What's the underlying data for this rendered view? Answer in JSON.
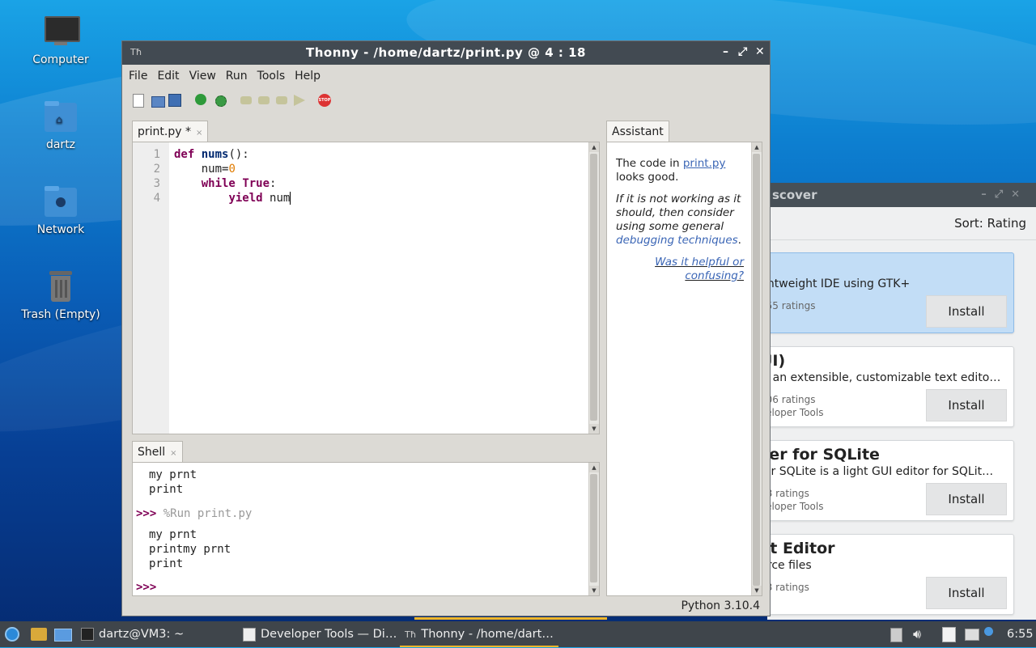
{
  "desktop": {
    "icons": [
      {
        "label": "Computer",
        "icon": "monitor-icon"
      },
      {
        "label": "dartz",
        "icon": "home-folder-icon"
      },
      {
        "label": "Network",
        "icon": "network-folder-icon"
      },
      {
        "label": "Trash (Empty)",
        "icon": "trash-icon"
      }
    ]
  },
  "discover": {
    "title": "scover",
    "sort_label": "Sort: Rating",
    "cards": [
      {
        "title": "",
        "desc": "ghtweight IDE using GTK+",
        "ratings": "155 ratings",
        "category": "",
        "install": "Install",
        "selected": true
      },
      {
        "title": "UI)",
        "desc": "is an extensible, customizable text edito…",
        "ratings": "106 ratings",
        "category": "veloper Tools",
        "install": "Install",
        "selected": false
      },
      {
        "title": "ser for SQLite",
        "desc": "for SQLite is a light GUI editor for SQLit…",
        "ratings": "88 ratings",
        "category": "veloper Tools",
        "install": "Install",
        "selected": false
      },
      {
        "title": "xt Editor",
        "desc": "urce files",
        "ratings": "18 ratings",
        "category": "",
        "install": "Install",
        "selected": false
      }
    ]
  },
  "thonny": {
    "app_icon": "Tħ",
    "title": "Thonny  -  /home/dartz/print.py  @  4 : 18",
    "window_buttons": {
      "minimize": "–",
      "maximize": "⤢",
      "close": "✕"
    },
    "menu": [
      "File",
      "Edit",
      "View",
      "Run",
      "Tools",
      "Help"
    ],
    "editor": {
      "tab_label": "print.py *",
      "line_numbers": [
        "1",
        "2",
        "3",
        "4"
      ]
    },
    "assistant": {
      "tab_label": "Assistant",
      "line1_prefix": "The code in ",
      "line1_link": "print.py",
      "line2": "looks good.",
      "para2_a": "If it is not working as it should, then consider using some general ",
      "para2_link": "debugging techniques",
      "para2_end": ".",
      "feedback_link_1": "Was it helpful or",
      "feedback_link_2": "confusing?"
    },
    "shell": {
      "tab_label": "Shell",
      "lines_before": [
        "my prnt",
        "print"
      ],
      "prompt": ">>>",
      "run_cmd": "%Run print.py",
      "lines_after": [
        "my prnt",
        "printmy prnt",
        "print"
      ]
    },
    "status": "Python 3.10.4"
  },
  "taskbar": {
    "items": [
      {
        "label": "dartz@VM3: ~",
        "icon": "terminal-icon"
      },
      {
        "label": "Developer Tools — Di…",
        "icon": "discover-icon"
      },
      {
        "label": "Thonny  -  /home/dart…",
        "icon": "thonny-icon",
        "active": true
      }
    ],
    "clock": "6:55"
  },
  "colors": {
    "accent": "#f5b72a",
    "keyword": "#7f0055",
    "link": "#3a65b5"
  }
}
